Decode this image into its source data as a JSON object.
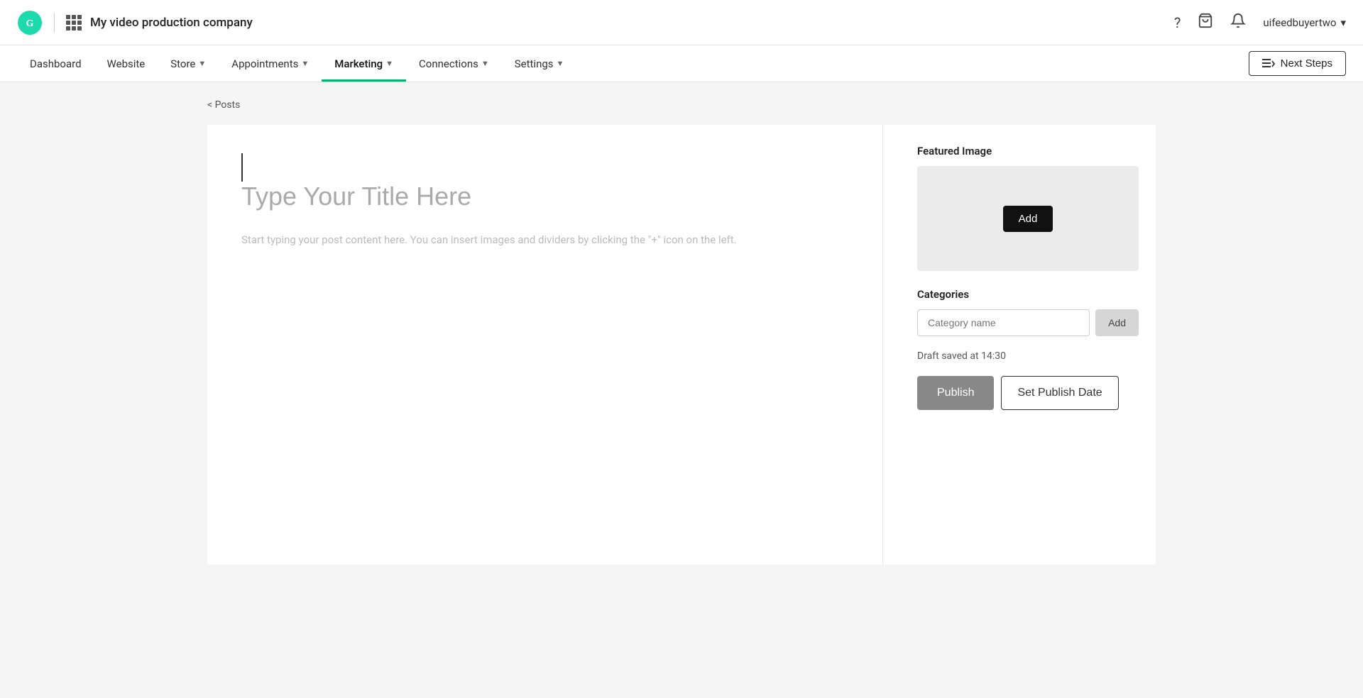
{
  "brand": {
    "logo_alt": "GoDaddy",
    "company_name": "My video production company"
  },
  "topbar": {
    "help_icon": "?",
    "cart_icon": "🛒",
    "bell_icon": "🔔",
    "user_name": "uifeedbuyertwo",
    "user_chevron": "▾"
  },
  "nav": {
    "items": [
      {
        "label": "Dashboard",
        "active": false,
        "has_dropdown": false
      },
      {
        "label": "Website",
        "active": false,
        "has_dropdown": false
      },
      {
        "label": "Store",
        "active": false,
        "has_dropdown": true
      },
      {
        "label": "Appointments",
        "active": false,
        "has_dropdown": true
      },
      {
        "label": "Marketing",
        "active": true,
        "has_dropdown": true
      },
      {
        "label": "Connections",
        "active": false,
        "has_dropdown": true
      },
      {
        "label": "Settings",
        "active": false,
        "has_dropdown": true
      }
    ],
    "next_steps_label": "Next Steps"
  },
  "breadcrumb": {
    "back_label": "< Posts"
  },
  "editor": {
    "title_placeholder": "Type Your Title Here",
    "content_placeholder": "Start typing your post content here. You can insert images and dividers by clicking the \"+\" icon on the left."
  },
  "sidebar": {
    "featured_image_label": "Featured Image",
    "add_image_btn": "Add",
    "categories_label": "Categories",
    "category_input_placeholder": "Category name",
    "add_category_btn": "Add",
    "draft_status": "Draft saved at 14:30",
    "publish_btn": "Publish",
    "set_publish_date_btn": "Set Publish Date"
  }
}
